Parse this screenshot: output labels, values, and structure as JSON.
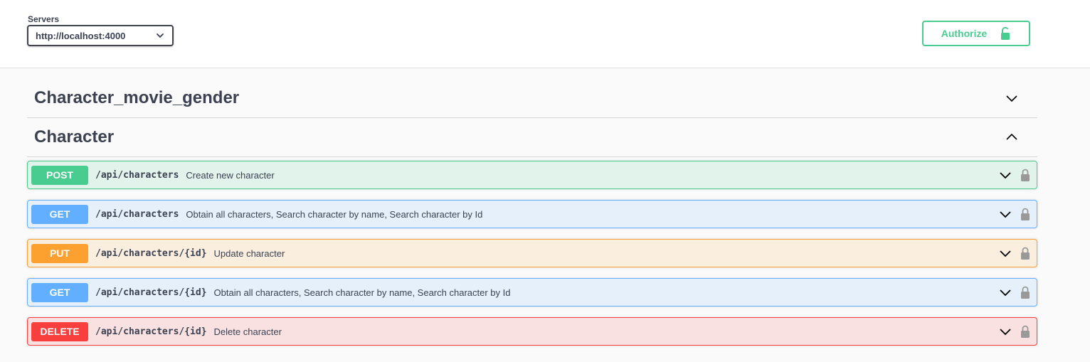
{
  "servers": {
    "label": "Servers",
    "selected": "http://localhost:4000"
  },
  "authorize": {
    "label": "Authorize",
    "icon": "unlocked-icon",
    "color": "#49cc90"
  },
  "tags": [
    {
      "name": "Character_movie_gender",
      "expanded": false
    },
    {
      "name": "Character",
      "expanded": true
    }
  ],
  "operations": [
    {
      "method": "POST",
      "path": "/api/characters",
      "summary": "Create new character",
      "color": "#49cc90"
    },
    {
      "method": "GET",
      "path": "/api/characters",
      "summary": "Obtain all characters, Search character by name, Search character by Id",
      "color": "#61affe"
    },
    {
      "method": "PUT",
      "path": "/api/characters/{id}",
      "summary": "Update character",
      "color": "#fca130"
    },
    {
      "method": "GET",
      "path": "/api/characters/{id}",
      "summary": "Obtain all characters, Search character by name, Search character by Id",
      "color": "#61affe"
    },
    {
      "method": "DELETE",
      "path": "/api/characters/{id}",
      "summary": "Delete character",
      "color": "#f93e3e"
    }
  ]
}
